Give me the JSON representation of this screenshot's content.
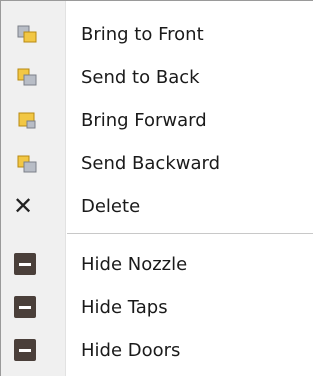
{
  "menu": {
    "items": [
      {
        "label": "Bring to Front",
        "icon": "bring-to-front-icon"
      },
      {
        "label": "Send to Back",
        "icon": "send-to-back-icon"
      },
      {
        "label": "Bring Forward",
        "icon": "bring-forward-icon"
      },
      {
        "label": "Send Backward",
        "icon": "send-backward-icon"
      },
      {
        "label": "Delete",
        "icon": "delete-icon"
      },
      {
        "label": "Hide Nozzle",
        "icon": "hide-icon"
      },
      {
        "label": "Hide Taps",
        "icon": "hide-icon"
      },
      {
        "label": "Hide Doors",
        "icon": "hide-icon"
      }
    ],
    "colors": {
      "icon_gold": "#f2c744",
      "icon_gray": "#b8bdc6",
      "hide_icon": "#4a3f3a"
    }
  }
}
